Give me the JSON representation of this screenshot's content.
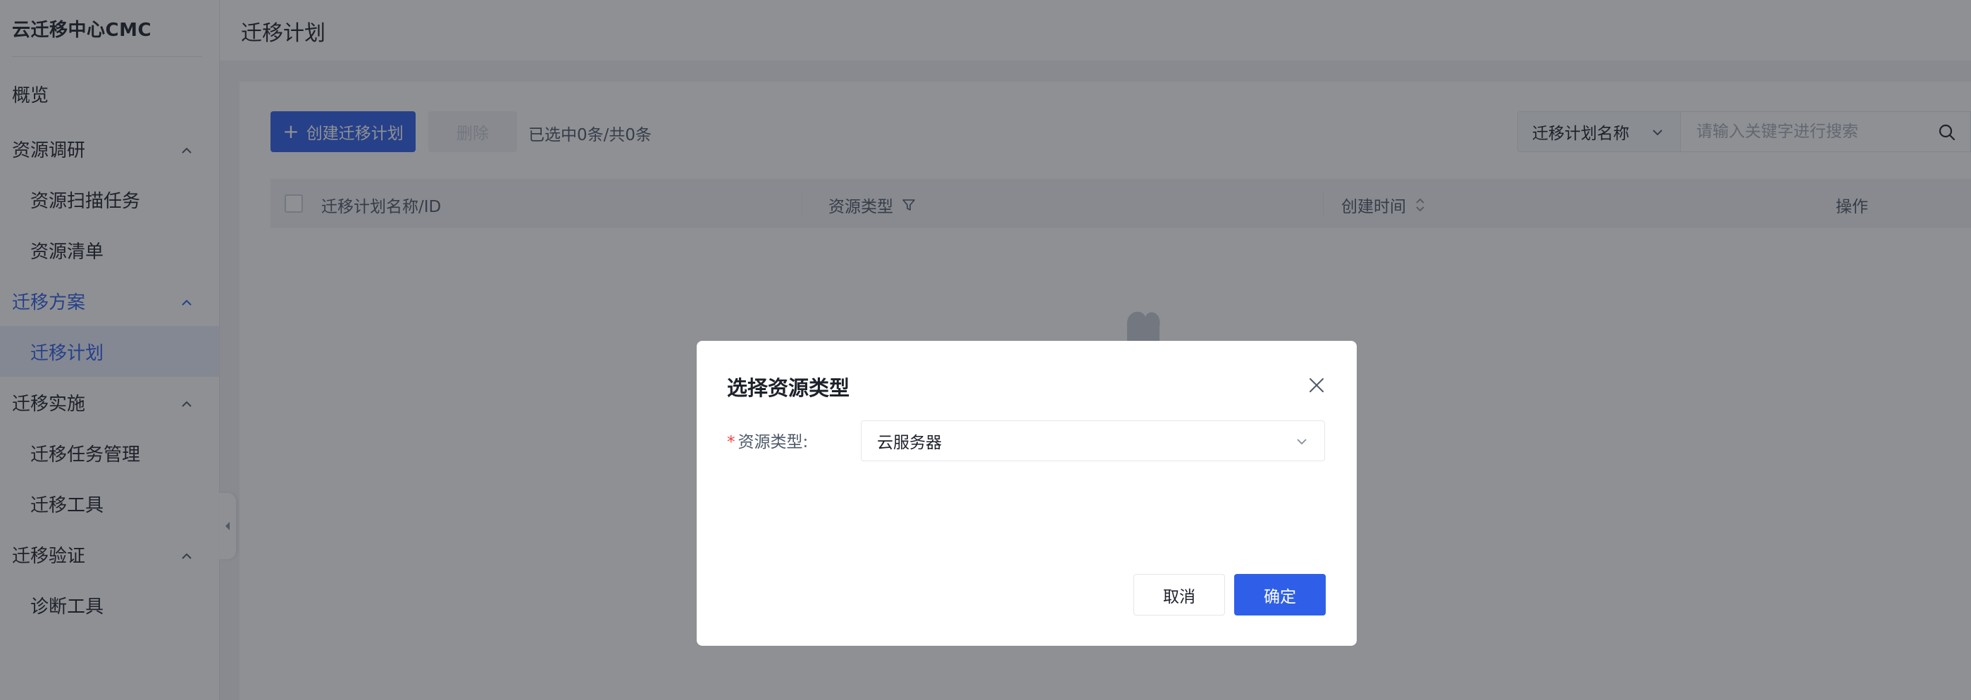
{
  "sidebar": {
    "brand": "云迁移中心CMC",
    "items": [
      {
        "label": "概览"
      },
      {
        "label": "资源调研"
      },
      {
        "label": "资源扫描任务"
      },
      {
        "label": "资源清单"
      },
      {
        "label": "迁移方案"
      },
      {
        "label": "迁移计划"
      },
      {
        "label": "迁移实施"
      },
      {
        "label": "迁移任务管理"
      },
      {
        "label": "迁移工具"
      },
      {
        "label": "迁移验证"
      },
      {
        "label": "诊断工具"
      }
    ]
  },
  "header": {
    "title": "迁移计划"
  },
  "toolbar": {
    "create_label": "创建迁移计划",
    "delete_label": "删除",
    "selection_info": "已选中0条/共0条",
    "filter_field": "迁移计划名称",
    "search_placeholder": "请输入关键字进行搜索"
  },
  "table": {
    "columns": [
      "迁移计划名称/ID",
      "资源类型",
      "创建时间",
      "操作"
    ]
  },
  "modal": {
    "title": "选择资源类型",
    "field_label": "资源类型:",
    "field_value": "云服务器",
    "cancel_label": "取消",
    "ok_label": "确定"
  },
  "colors": {
    "primary": "#2f5fe8",
    "required": "#f53f3f",
    "overlay": "rgba(29,33,41,0.5)"
  }
}
